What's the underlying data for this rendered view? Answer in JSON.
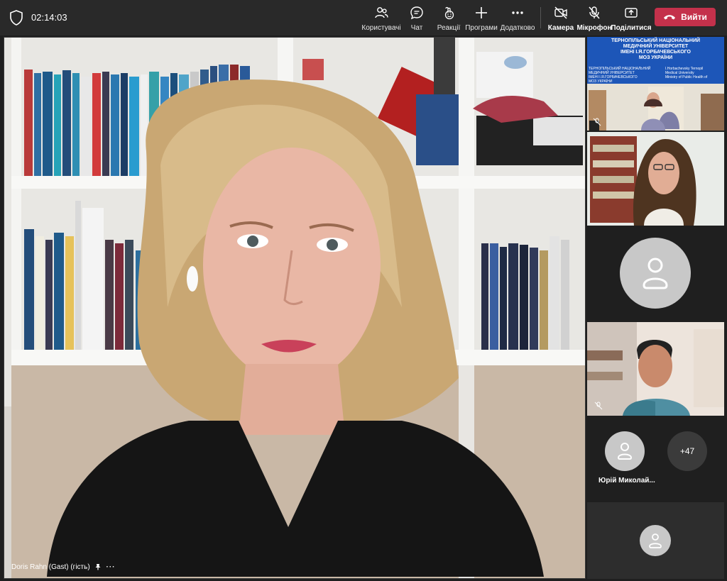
{
  "meeting": {
    "timer": "02:14:03"
  },
  "toolbar": {
    "people_label": "Користувачі",
    "chat_label": "Чат",
    "reactions_label": "Реакції",
    "apps_label": "Програми",
    "more_label": "Додатково",
    "camera_label": "Камера",
    "mic_label": "Мікрофон",
    "share_label": "Поділитися",
    "leave_label": "Вийти"
  },
  "icons": {
    "shield": "shield-icon",
    "people": "people-icon",
    "chat": "chat-icon",
    "reactions": "emoji-icon",
    "apps": "plus-icon",
    "more": "more-dots-icon",
    "camera": "camera-off-icon",
    "mic": "mic-off-icon",
    "share": "share-tray-icon",
    "leave": "phone-hangup-icon",
    "pin": "pin-icon",
    "avatar": "person-avatar-icon"
  },
  "colors": {
    "topbar": "#292929",
    "leave_button": "#c4314b",
    "selected_tile": "#7f85f5",
    "background": "#1f1f1f"
  },
  "main_video": {
    "participant_name": "Doris Rahn (Gast) (гість)",
    "options": "⋯"
  },
  "rail": {
    "tile1_banner": {
      "line1": "ТЕРНОПІЛЬСЬКИЙ НАЦІОНАЛЬНИЙ",
      "line2": "МЕДИЧНИЙ УНІВЕРСИТЕТ",
      "line3": "ІМЕНІ І.Я.ГОРБАЧЕВСЬКОГО",
      "line4": "МОЗ УКРАЇНИ",
      "sub_left_1": "ТЕРНОПІЛЬСЬКИЙ НАЦІОНАЛЬНИЙ",
      "sub_left_2": "МЕДИЧНИЙ УНІВЕРСИТЕТ",
      "sub_left_3": "ІМЕНІ І.Я.ГОРБАЧЕВСЬКОГО",
      "sub_left_4": "МОЗ УКРАЇНИ",
      "sub_right_1": "I.Horbachevsky Ternopil",
      "sub_right_2": "Medical University",
      "sub_right_3": "Ministry of Public Health of"
    },
    "overflow_count": "+47",
    "named_participant": "Юрій Миколай..."
  }
}
